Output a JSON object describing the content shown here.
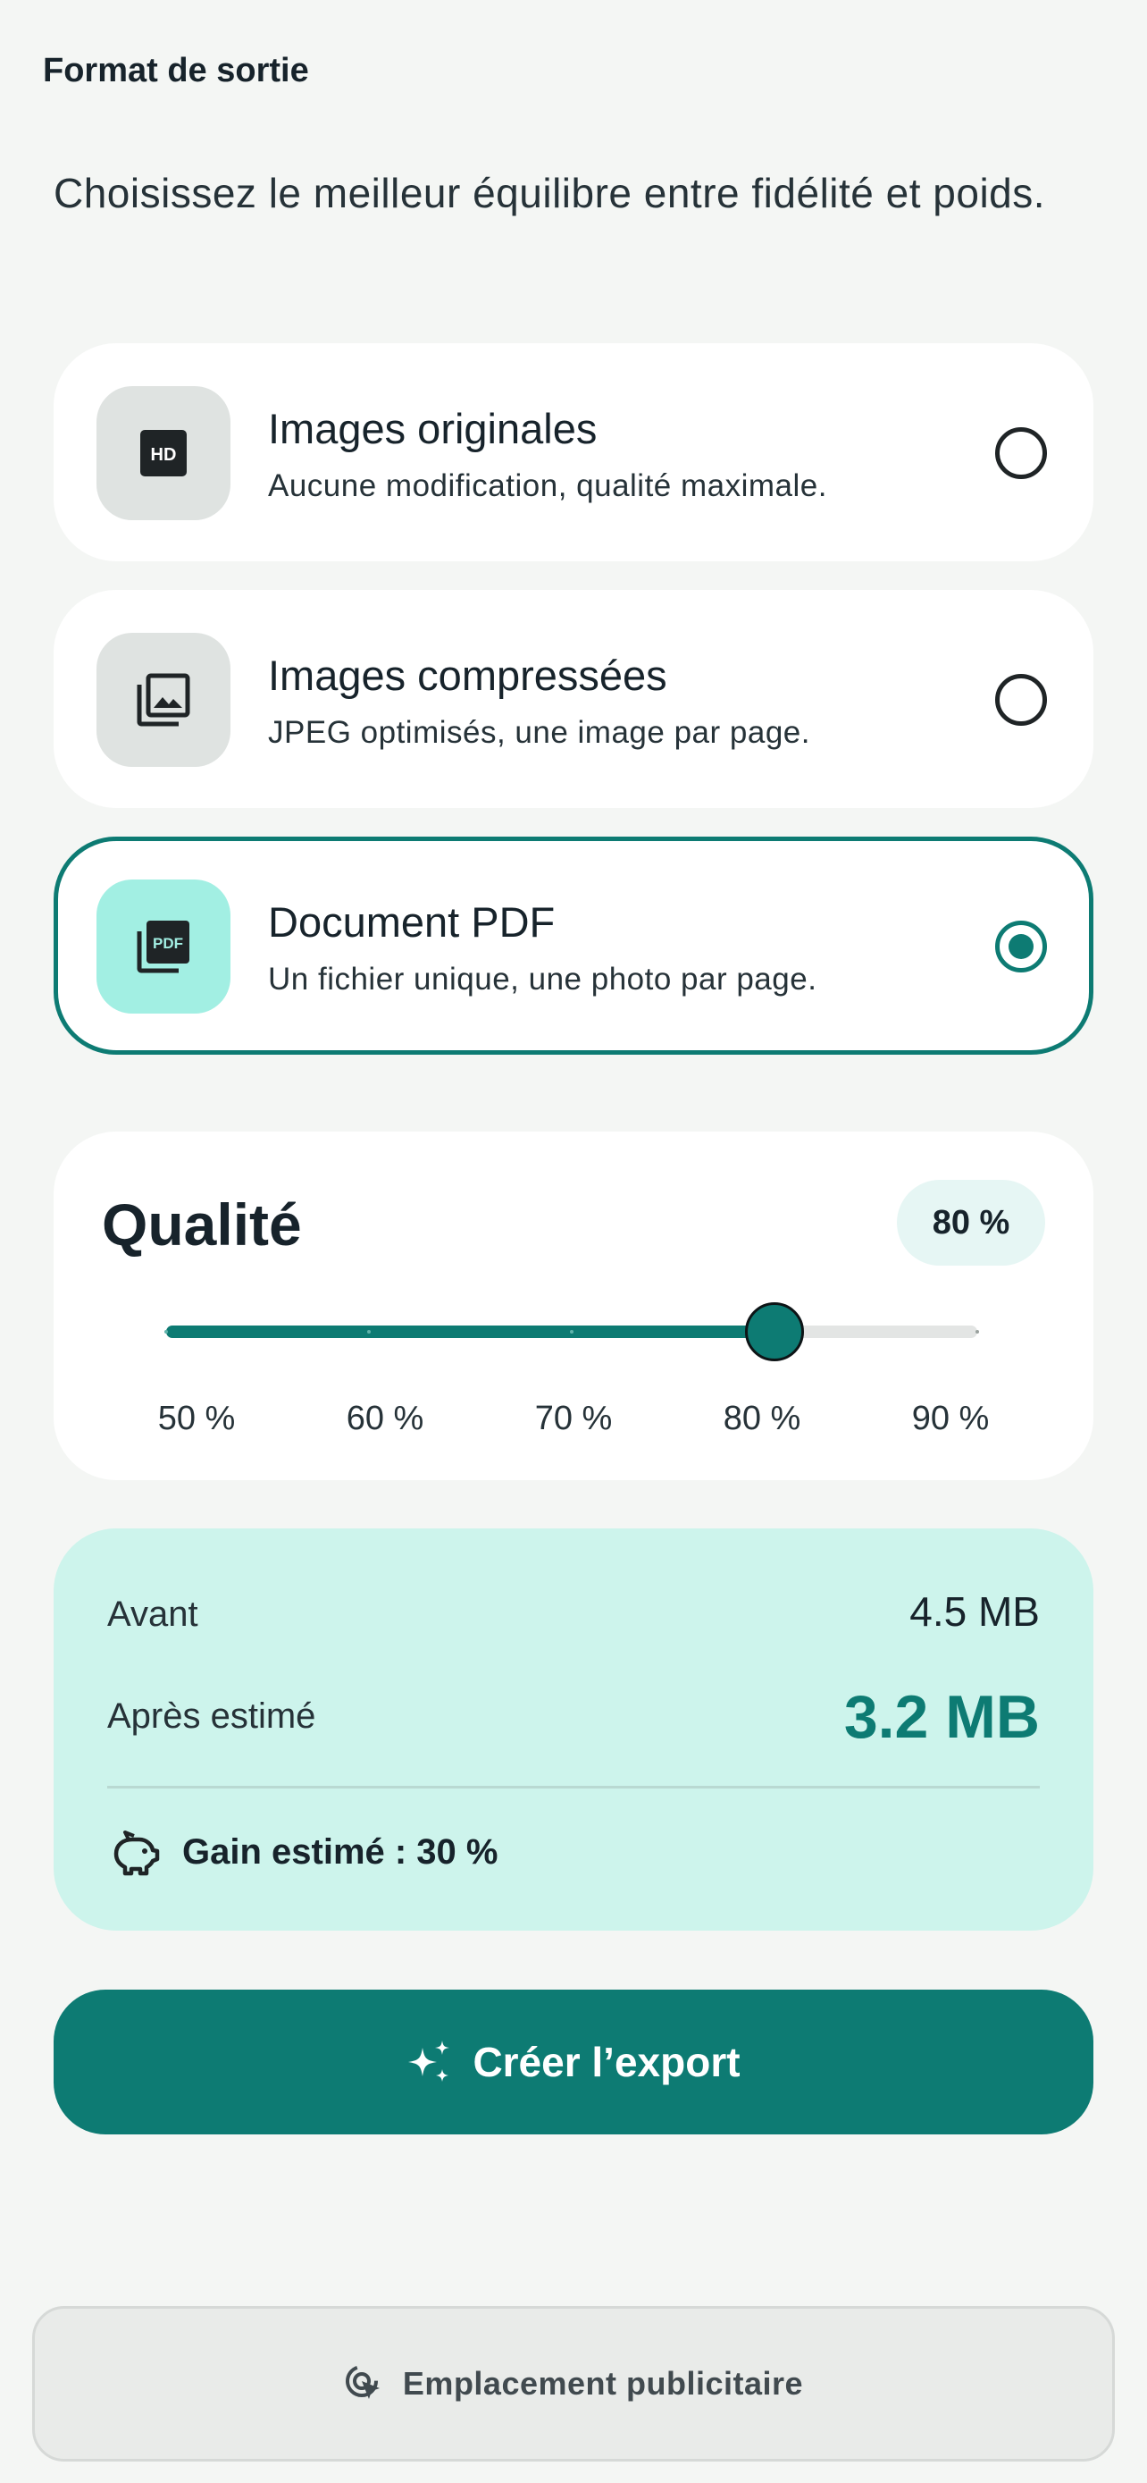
{
  "header": {
    "title": "Format de sortie"
  },
  "intro": {
    "text": "Choisissez le meilleur équilibre entre fidélité et poids."
  },
  "options": [
    {
      "title": "Images originales",
      "description": "Aucune modification, qualité maximale.",
      "icon": "hd-icon",
      "selected": false
    },
    {
      "title": "Images compressées",
      "description": "JPEG optimisés, une image par page.",
      "icon": "photo-library-icon",
      "selected": false
    },
    {
      "title": "Document PDF",
      "description": "Un fichier unique, une photo par page.",
      "icon": "pdf-icon",
      "selected": true
    }
  ],
  "quality": {
    "title": "Qualité",
    "badge": "80 %",
    "value_percent": 80,
    "min_percent": 50,
    "max_percent": 90,
    "ticks": [
      "50 %",
      "60 %",
      "70 %",
      "80 %",
      "90 %"
    ]
  },
  "estimate": {
    "before_label": "Avant",
    "before_value": "4.5 MB",
    "after_label": "Après estimé",
    "after_value": "3.2 MB",
    "gain_text": "Gain estimé : 30 %",
    "gain_icon": "piggy-bank-icon"
  },
  "export_button": {
    "label": "Créer l’export",
    "icon": "sparkle-icon"
  },
  "ad": {
    "label": "Emplacement publicitaire",
    "icon": "ad-click-icon"
  },
  "colors": {
    "accent": "#0d7b73",
    "background": "#f4f6f4",
    "card": "#ffffff",
    "estimate_card": "#cdf4ec",
    "selected_icon_bg": "#a2efe3"
  }
}
